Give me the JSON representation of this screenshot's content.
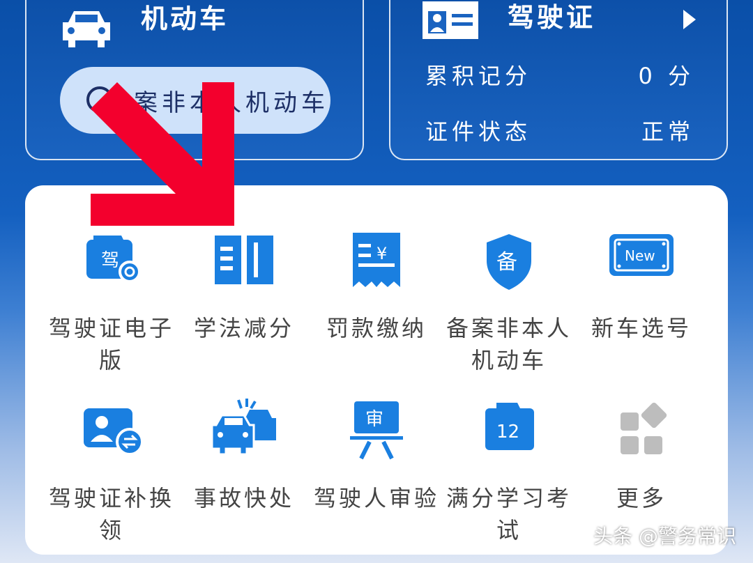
{
  "vehicle_card": {
    "title": "机动车",
    "pill_label": "备案非本人机动车"
  },
  "license_card": {
    "title": "驾驶证",
    "rows": [
      {
        "label": "累积记分",
        "value": "0 分"
      },
      {
        "label": "证件状态",
        "value": "正常"
      }
    ]
  },
  "services": [
    {
      "label": "驾驶证电子版",
      "icon": "e-license-icon"
    },
    {
      "label": "学法减分",
      "icon": "book-icon"
    },
    {
      "label": "罚款缴纳",
      "icon": "receipt-icon"
    },
    {
      "label": "备案非本人机动车",
      "icon": "shield-icon",
      "badge": "备"
    },
    {
      "label": "新车选号",
      "icon": "new-plate-icon",
      "badge": "New"
    },
    {
      "label": "驾驶证补换领",
      "icon": "license-exchange-icon"
    },
    {
      "label": "事故快处",
      "icon": "accident-icon"
    },
    {
      "label": "驾驶人审验",
      "icon": "review-icon",
      "badge": "审"
    },
    {
      "label": "满分学习考试",
      "icon": "calendar-icon",
      "badge": "12"
    },
    {
      "label": "更多",
      "icon": "more-grid-icon"
    }
  ],
  "license_badge": "驾",
  "watermark": "头条 @警务常识",
  "colors": {
    "primary": "#1a7fe0",
    "arrow": "#f3002d",
    "bg_top": "#0a4fa8"
  }
}
